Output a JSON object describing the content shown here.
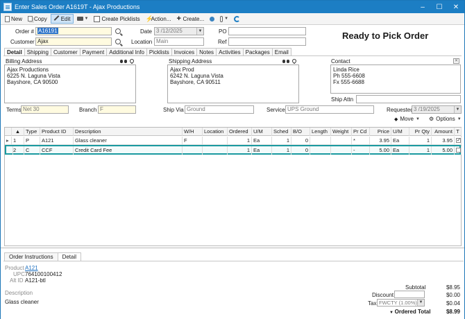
{
  "window": {
    "title": "Enter Sales Order A1619T - Ajax Productions",
    "min": "–",
    "max": "☐",
    "close": "✕"
  },
  "toolbar": {
    "new": "New",
    "copy": "Copy",
    "edit": "Edit",
    "create_picklists": "Create Picklists",
    "action": "Action...",
    "create": "Create..."
  },
  "header": {
    "order_label": "Order #",
    "order_value": "A16191",
    "customer_label": "Customer",
    "customer_value": "Ajax",
    "date_label": "Date",
    "date_value": "3 /12/2025",
    "location_label": "Location",
    "location_value": "Main",
    "po_label": "PO",
    "po_value": "",
    "ref_label": "Ref",
    "ref_value": "",
    "status": "Ready to Pick Order"
  },
  "tabs": [
    "Detail",
    "Shipping",
    "Customer",
    "Payment",
    "Additional Info",
    "Picklists",
    "Invoices",
    "Notes",
    "Activities",
    "Packages",
    "Email"
  ],
  "billing": {
    "label": "Billing Address",
    "lines": [
      "Ajax Productions",
      "6225 N. Laguna Vista",
      "Bayshore, CA 90500"
    ]
  },
  "shipping": {
    "label": "Shipping Address",
    "lines": [
      "Ajax Prod",
      "6242 N. Laguna Vista",
      "Bayshore, CA 90511"
    ]
  },
  "contact": {
    "label": "Contact",
    "lines": [
      "Linda Rice",
      "Ph 555-6608",
      "Fx 555-6688"
    ],
    "ship_attn_label": "Ship Attn",
    "ship_attn_value": ""
  },
  "terms": {
    "terms_label": "Terms",
    "terms_value": "Net 30",
    "branch_label": "Branch",
    "branch_value": "F",
    "shipvia_label": "Ship Via",
    "shipvia_value": "Ground",
    "service_label": "Service",
    "service_value": "UPS Ground",
    "requested_label": "Requested",
    "requested_value": "3 /19/2025"
  },
  "grid": {
    "tools": {
      "move": "Move",
      "options": "Options"
    },
    "columns": [
      "",
      "Type",
      "Product ID",
      "Description",
      "W/H",
      "Location",
      "Ordered",
      "U/M",
      "Sched",
      "B/O",
      "Length",
      "Weight",
      "Pr Cd",
      "Price",
      "U/M",
      "Pr Qty",
      "Amount",
      "T"
    ],
    "rows": [
      {
        "arrow": "▸",
        "num": "1",
        "type": "P",
        "product": "A121",
        "desc": "Glass cleaner",
        "wh": "F",
        "location": "",
        "ordered": "1",
        "um": "Ea",
        "sched": "1",
        "bo": "0",
        "length": "",
        "weight": "",
        "prcd": "*",
        "price": "3.95",
        "um2": "Ea",
        "prqty": "1",
        "amount": "3.95",
        "taxed": true
      },
      {
        "arrow": "",
        "num": "2",
        "type": "C",
        "product": "CCF",
        "desc": "Credit Card Fee",
        "wh": "",
        "location": "",
        "ordered": "1",
        "um": "Ea",
        "sched": "1",
        "bo": "0",
        "length": "",
        "weight": "",
        "prcd": "-",
        "price": "5.00",
        "um2": "Ea",
        "prqty": "1",
        "amount": "5.00",
        "taxed": false
      }
    ]
  },
  "bottom": {
    "tabs": [
      "Order Instructions",
      "Detail"
    ],
    "product_label": "Product",
    "product_value": "A121",
    "upc_label": "UPC",
    "upc_value": "764100100412",
    "altid_label": "Alt ID",
    "altid_value": "A121-btl",
    "description_label": "Description",
    "description_value": "Glass cleaner"
  },
  "totals": {
    "subtotal_label": "Subtotal",
    "subtotal_value": "$8.95",
    "discount_label": "Discount",
    "discount_value": "$0.00",
    "tax_label": "Tax",
    "tax_code": "FWCTY (1.00%)",
    "tax_value": "$0.04",
    "ordered_label": "Ordered Total",
    "ordered_value": "$8.99"
  }
}
